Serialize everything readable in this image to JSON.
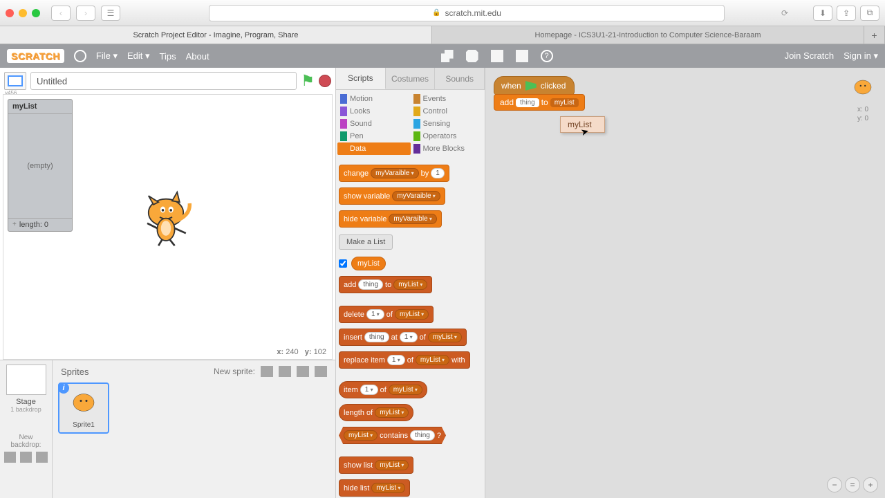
{
  "browser": {
    "url_host": "scratch.mit.edu",
    "tabs": {
      "active": "Scratch Project Editor - Imagine, Program, Share",
      "other": "Homepage - ICS3U1-21-Introduction to Computer Science-Baraam"
    }
  },
  "menu": {
    "logo": "SCRATCH",
    "file": "File ▾",
    "edit": "Edit ▾",
    "tips": "Tips",
    "about": "About",
    "join": "Join Scratch",
    "signin": "Sign in ▾"
  },
  "stage": {
    "view_label": "v456",
    "title": "Untitled",
    "list_monitor": {
      "name": "myList",
      "body": "(empty)",
      "footer": "length: 0"
    },
    "coords": {
      "xl": "x:",
      "x": "240",
      "yl": "y:",
      "y": "102"
    }
  },
  "sprite_area": {
    "stage_label": "Stage",
    "backdrop_count": "1 backdrop",
    "new_backdrop": "New backdrop:",
    "header": "Sprites",
    "new_sprite": "New sprite:",
    "sprite1": "Sprite1"
  },
  "tabs": {
    "scripts": "Scripts",
    "costumes": "Costumes",
    "sounds": "Sounds"
  },
  "categories": [
    {
      "n": "Motion",
      "c": "#4a6cd4"
    },
    {
      "n": "Events",
      "c": "#c88330"
    },
    {
      "n": "Looks",
      "c": "#8a55d7"
    },
    {
      "n": "Control",
      "c": "#e1a91a"
    },
    {
      "n": "Sound",
      "c": "#bb42c3"
    },
    {
      "n": "Sensing",
      "c": "#2ca5e2"
    },
    {
      "n": "Pen",
      "c": "#0e9a6c"
    },
    {
      "n": "Operators",
      "c": "#5cb712"
    },
    {
      "n": "Data",
      "c": "#ee7d16",
      "sel": true
    },
    {
      "n": "More Blocks",
      "c": "#632d99"
    }
  ],
  "palette": {
    "change": {
      "l": "change",
      "v": "myVaraible",
      "by": "by",
      "n": "1"
    },
    "showv": {
      "l": "show variable",
      "v": "myVaraible"
    },
    "hidev": {
      "l": "hide variable",
      "v": "myVaraible"
    },
    "make_list": "Make a List",
    "list_rep": "myList",
    "add": {
      "l": "add",
      "t": "thing",
      "to": "to",
      "v": "myList"
    },
    "delete": {
      "l": "delete",
      "n": "1",
      "of": "of",
      "v": "myList"
    },
    "insert": {
      "l": "insert",
      "t": "thing",
      "at": "at",
      "n": "1",
      "of": "of",
      "v": "myList"
    },
    "replace": {
      "l": "replace item",
      "n": "1",
      "of": "of",
      "v": "myList",
      "with": "with"
    },
    "item": {
      "l": "item",
      "n": "1",
      "of": "of",
      "v": "myList"
    },
    "length": {
      "l": "length of",
      "v": "myList"
    },
    "contains": {
      "v": "myList",
      "l": "contains",
      "t": "thing",
      "q": "?"
    },
    "showl": {
      "l": "show list",
      "v": "myList"
    },
    "hidel": {
      "l": "hide list",
      "v": "myList"
    }
  },
  "script": {
    "hat": {
      "when": "when",
      "clicked": "clicked"
    },
    "add": {
      "l": "add",
      "t": "thing",
      "to": "to",
      "v": "myList"
    },
    "dropdown": "myList"
  },
  "sprite_coords": {
    "xl": "x:",
    "x": "0",
    "yl": "y:",
    "y": "0"
  }
}
